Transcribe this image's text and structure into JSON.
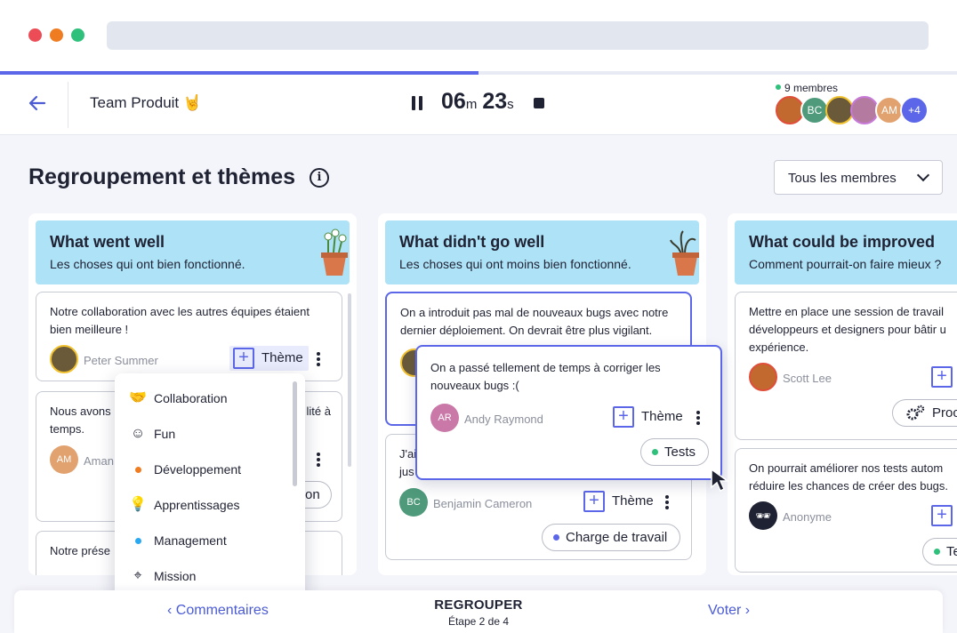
{
  "window": {
    "controls": [
      "close",
      "minimize",
      "maximize"
    ]
  },
  "progress": {
    "fraction": 0.5
  },
  "header": {
    "back_icon": "arrow-left-icon",
    "team_name": "Team Produit 🤘",
    "timer": {
      "minutes": "06",
      "minutes_unit": "m",
      "seconds": "23",
      "seconds_unit": "s"
    },
    "members_label": "9 membres",
    "avatars": [
      {
        "initials": "",
        "color": "#c2692f",
        "ring": "#e04e3a"
      },
      {
        "initials": "BC",
        "color": "#4e9a7b",
        "ring": "#ffffff"
      },
      {
        "initials": "",
        "color": "#6a5a3a",
        "ring": "#f2c12e"
      },
      {
        "initials": "",
        "color": "#b57aa0",
        "ring": "#c77ad8"
      },
      {
        "initials": "AM",
        "color": "#e2a26f",
        "ring": "#ffffff"
      },
      {
        "initials": "+4",
        "color": "#5b67e8",
        "ring": "#ffffff"
      }
    ]
  },
  "page": {
    "title": "Regroupement et thèmes",
    "filter_value": "Tous les membres"
  },
  "columns": [
    {
      "title": "What went well",
      "subtitle": "Les choses qui ont bien fonctionné.",
      "cards": [
        {
          "text": "Notre collaboration avec les autres équipes étaient bien meilleure !",
          "author": "Peter Summer",
          "theme_label": "Thème"
        },
        {
          "text": "Nous avons ",
          "text_right": "lité à",
          "text2": "temps.",
          "author": "Aman",
          "tag_partial": "on"
        },
        {
          "text": "Notre prése"
        }
      ]
    },
    {
      "title": "What didn't go well",
      "subtitle": "Les choses qui ont moins bien fonctionné.",
      "cards": [
        {
          "text": "On a introduit pas mal de nouveaux bugs avec notre dernier déploiement. On devrait être plus vigilant."
        },
        {
          "text": "J'ai",
          "text2": "jus",
          "author": "Benjamin Cameron",
          "author_initials": "BC",
          "theme_label": "Thème",
          "tag": "Charge de travail",
          "tag_color": "#5b67e8"
        }
      ]
    },
    {
      "title": "What could be improved",
      "subtitle": "Comment pourrait-on faire mieux ?",
      "cards": [
        {
          "text": "Mettre en place une session de travail développeurs et designers pour bâtir u expérience.",
          "author": "Scott Lee",
          "tag": "Proc"
        },
        {
          "text": "On pourrait améliorer nos tests autom réduire les chances de créer des bugs.",
          "author": "Anonyme",
          "tag": "Te",
          "tag_color": "#2fc07b"
        }
      ]
    }
  ],
  "dragged_card": {
    "text": "On a passé tellement de temps à corriger les nouveaux bugs :(",
    "author": "Andy Raymond",
    "author_initials": "AR",
    "theme_label": "Thème",
    "tag": "Tests",
    "tag_color": "#2fc07b"
  },
  "theme_menu": {
    "items": [
      {
        "label": "Collaboration",
        "icon": "handshake-icon"
      },
      {
        "label": "Fun",
        "icon": "smiley-icon"
      },
      {
        "label": "Développement",
        "icon": "dot",
        "color": "#f07c22"
      },
      {
        "label": "Apprentissages",
        "icon": "lightbulb-icon"
      },
      {
        "label": "Management",
        "icon": "dot",
        "color": "#2aa8f0"
      },
      {
        "label": "Mission",
        "icon": "crosshair-icon"
      }
    ]
  },
  "footer": {
    "prev_label": "Commentaires",
    "step_title": "REGROUPER",
    "step_subtitle": "Étape 2 de 4",
    "next_label": "Voter"
  }
}
